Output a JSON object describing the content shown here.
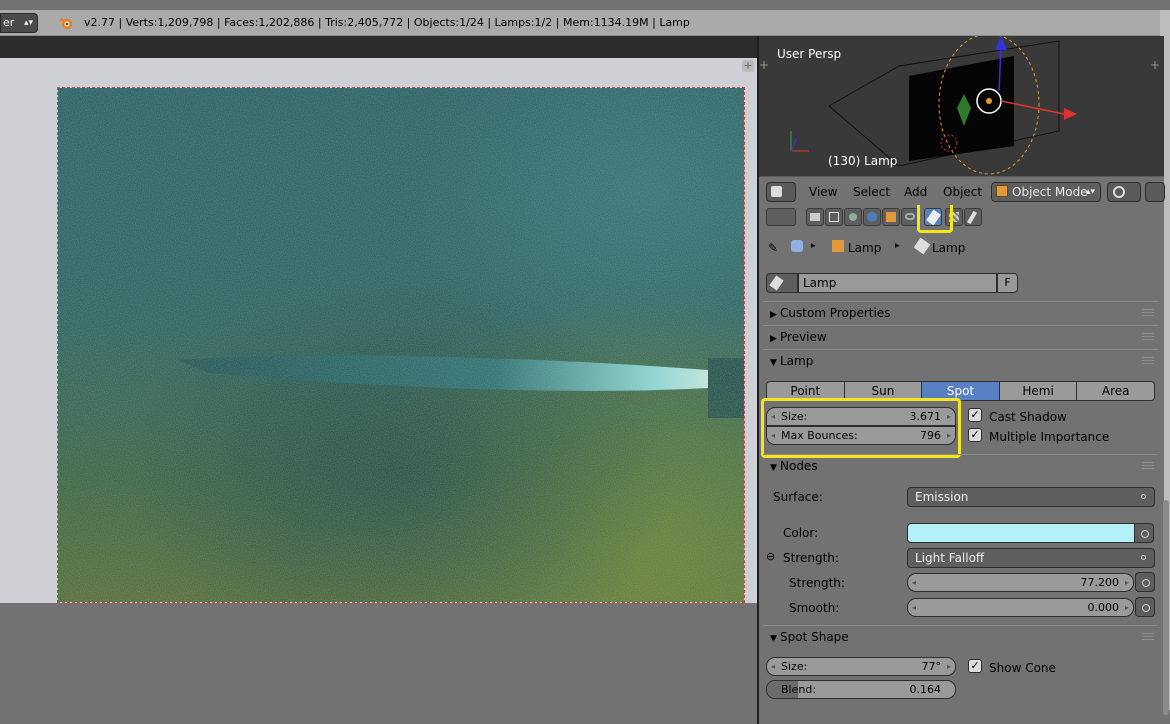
{
  "topbar": {
    "editor_label": "er",
    "stats": "v2.77 | Verts:1,209,798 | Faces:1,202,886 | Tris:2,405,772 | Objects:1/24 | Lamps:1/2 | Mem:1134.19M | Lamp"
  },
  "viewport": {
    "view_label": "User Persp",
    "object_label": "(130) Lamp"
  },
  "viewport_header": {
    "menu": [
      "View",
      "Select",
      "Add",
      "Object"
    ],
    "mode": "Object Mode"
  },
  "breadcrumb": {
    "items": [
      "Lamp",
      "Lamp"
    ]
  },
  "datablock": {
    "name": "Lamp",
    "fake_user": "F"
  },
  "panels": {
    "custom_properties": "Custom Properties",
    "preview": "Preview",
    "lamp": "Lamp",
    "nodes": "Nodes",
    "spot_shape": "Spot Shape"
  },
  "lamp": {
    "types": [
      "Point",
      "Sun",
      "Spot",
      "Hemi",
      "Area"
    ],
    "active_type": "Spot",
    "size_label": "Size:",
    "size_value": "3.671",
    "bounces_label": "Max Bounces:",
    "bounces_value": "796",
    "cast_shadow": "Cast Shadow",
    "multiple_importance": "Multiple Importance"
  },
  "nodes": {
    "surface_label": "Surface:",
    "surface_value": "Emission",
    "color_label": "Color:",
    "color_value": "#b3f0f7",
    "strength_label": "Strength:",
    "strength_node": "Light Falloff",
    "sub_strength_label": "Strength:",
    "sub_strength_value": "77.200",
    "smooth_label": "Smooth:",
    "smooth_value": "0.000"
  },
  "spot_shape": {
    "size_label": "Size:",
    "size_value": "77°",
    "blend_label": "Blend:",
    "blend_value": "0.164",
    "blend_fraction": 0.164,
    "show_cone": "Show Cone"
  },
  "colors": {
    "accent": "#5680c2",
    "highlight": "#f4e51c"
  }
}
